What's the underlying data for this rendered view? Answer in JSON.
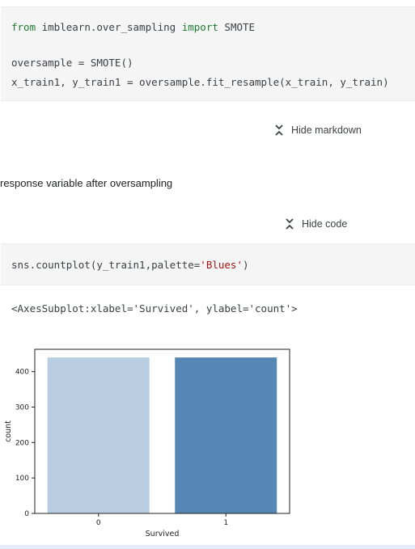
{
  "cell1": {
    "line1": {
      "kw1": "from",
      "mod": " imblearn.over_sampling ",
      "kw2": "import",
      "name": " SMOTE"
    },
    "line2": "oversample = SMOTE()",
    "line3": "x_train1, y_train1 = oversample.fit_resample(x_train, y_train)"
  },
  "toggle_markdown": {
    "label": "Hide markdown",
    "icon": "collapse-chevrons-icon"
  },
  "markdown_text": "response variable after oversampling",
  "toggle_code": {
    "label": "Hide code",
    "icon": "collapse-chevrons-icon"
  },
  "cell2": {
    "code_pre": "sns.countplot(y_train1,palette=",
    "code_str": "'Blues'",
    "code_post": ")"
  },
  "output_text": "<AxesSubplot:xlabel='Survived', ylabel='count'>",
  "chart_data": {
    "type": "bar",
    "categories": [
      "0",
      "1"
    ],
    "values": [
      440,
      440
    ],
    "colors": [
      "#b9cde0",
      "#5686b3"
    ],
    "xlabel": "Survived",
    "ylabel": "count",
    "ylim": [
      0,
      463
    ],
    "yticks": [
      0,
      100,
      200,
      300,
      400
    ],
    "grid": false
  }
}
